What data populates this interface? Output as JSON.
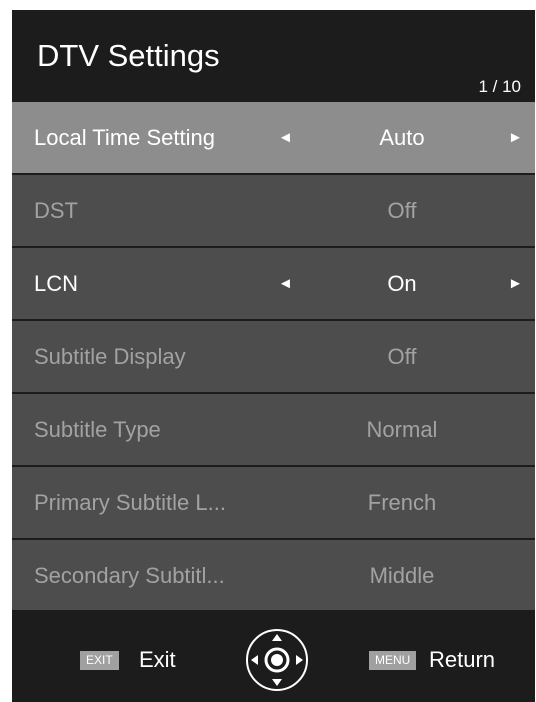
{
  "header": {
    "title": "DTV Settings",
    "page_indicator": "1 / 10"
  },
  "arrows": {
    "left": "◄",
    "right": "►"
  },
  "rows": [
    {
      "label": "Local Time Setting",
      "value": "Auto",
      "state": "selected"
    },
    {
      "label": "DST",
      "value": "Off",
      "state": "disabled"
    },
    {
      "label": "LCN",
      "value": "On",
      "state": "enabled"
    },
    {
      "label": "Subtitle Display",
      "value": "Off",
      "state": "disabled"
    },
    {
      "label": "Subtitle Type",
      "value": "Normal",
      "state": "disabled"
    },
    {
      "label": "Primary Subtitle L...",
      "value": "French",
      "state": "disabled"
    },
    {
      "label": "Secondary Subtitl...",
      "value": "Middle",
      "state": "disabled"
    }
  ],
  "footer": {
    "exit_key": "EXIT",
    "exit_label": "Exit",
    "menu_key": "MENU",
    "menu_label": "Return",
    "navigation_icon": "dpad-icon"
  },
  "colors": {
    "background": "#1c1c1c",
    "row": "#4d4d4d",
    "row_selected": "#8d8d8d",
    "text": "#ffffff",
    "text_disabled": "#a2a2a2",
    "key_badge": "#a0a0a0"
  }
}
